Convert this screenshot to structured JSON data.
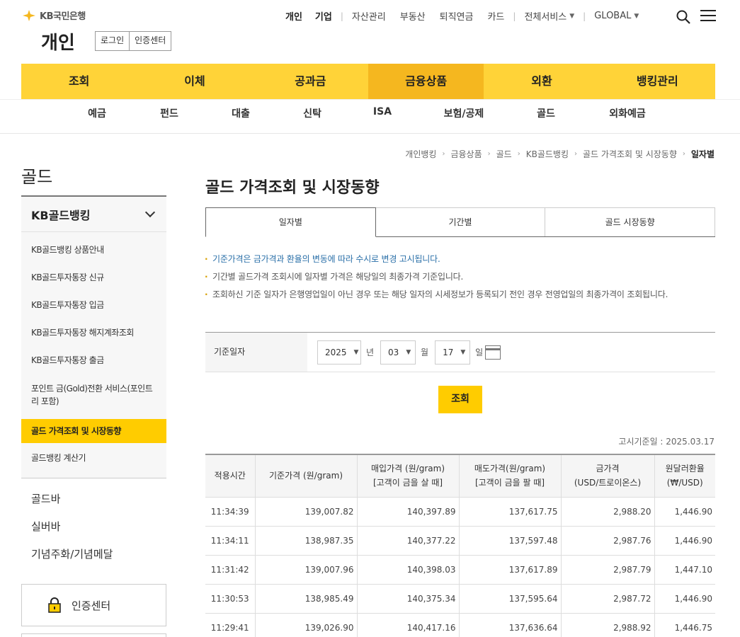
{
  "header": {
    "logo_text": "KB국민은행",
    "page_heading": "개인",
    "login_label": "로그인",
    "auth_center_label": "인증센터",
    "top_nav": [
      "개인",
      "기업",
      "자산관리",
      "부동산",
      "퇴직연금",
      "카드",
      "전체서비스",
      "GLOBAL"
    ]
  },
  "main_nav": [
    "조회",
    "이체",
    "공과금",
    "금융상품",
    "외환",
    "뱅킹관리"
  ],
  "main_nav_active": "금융상품",
  "sub_nav": [
    "예금",
    "펀드",
    "대출",
    "신탁",
    "ISA",
    "보험/공제",
    "골드",
    "외화예금"
  ],
  "breadcrumb": [
    "개인뱅킹",
    "금융상품",
    "골드",
    "KB골드뱅킹",
    "골드 가격조회 및 시장동향",
    "일자별"
  ],
  "sidebar": {
    "title": "골드",
    "group_label": "KB골드뱅킹",
    "items": [
      "KB골드뱅킹 상품안내",
      "KB골드투자통장 신규",
      "KB골드투자통장 입금",
      "KB골드투자통장 해지계좌조회",
      "KB골드투자통장 출금",
      "포인트 금(Gold)전환 서비스(포인트리 포함)",
      "골드 가격조회 및 시장동향",
      "골드뱅킹 계산기"
    ],
    "links": [
      "골드바",
      "실버바",
      "기념주화/기념메달"
    ],
    "auth_center": "인증센터"
  },
  "content": {
    "title": "골드 가격조회 및 시장동향",
    "tabs": [
      "일자별",
      "기간별",
      "골드 시장동향"
    ],
    "notes": [
      "기준가격은 금가격과 환율의 변동에 따라 수시로 변경 고시됩니다.",
      "기간별 골드가격 조회시에 일자별 가격은 해당일의 최종가격 기준입니다.",
      "조회하신 기준 일자가 은행영업일이 아닌 경우 또는 해당 일자의 시세정보가 등록되기 전인 경우 전영업일의 최종가격이 조회됩니다."
    ],
    "date_label": "기준일자",
    "year": "2025",
    "year_unit": "년",
    "month": "03",
    "month_unit": "월",
    "day": "17",
    "day_unit": "일",
    "search_button": "조회",
    "notice_date": "고시기준일 : 2025.03.17"
  },
  "table": {
    "headers": [
      [
        "적용시간"
      ],
      [
        "기준가격 (원/gram)"
      ],
      [
        "매입가격 (원/gram)",
        "[고객이 금을 살 때]"
      ],
      [
        "매도가격(원/gram)",
        "[고객이 금을 팔 때]"
      ],
      [
        "금가격",
        "(USD/트로이온스)"
      ],
      [
        "원달러환율",
        "(₩/USD)"
      ]
    ],
    "rows": [
      [
        "11:34:39",
        "139,007.82",
        "140,397.89",
        "137,617.75",
        "2,988.20",
        "1,446.90"
      ],
      [
        "11:34:11",
        "138,987.35",
        "140,377.22",
        "137,597.48",
        "2,987.76",
        "1,446.90"
      ],
      [
        "11:31:42",
        "139,007.96",
        "140,398.03",
        "137,617.89",
        "2,987.79",
        "1,447.10"
      ],
      [
        "11:30:53",
        "138,985.49",
        "140,375.34",
        "137,595.64",
        "2,987.72",
        "1,446.90"
      ],
      [
        "11:29:41",
        "139,026.90",
        "140,417.16",
        "137,636.64",
        "2,988.92",
        "1,446.75"
      ]
    ]
  },
  "colors": {
    "brand_yellow": "#ffd338",
    "active_tab": "#f5b71f",
    "sidebar_active": "#ffcc00"
  }
}
